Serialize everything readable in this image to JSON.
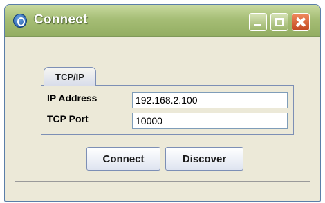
{
  "window": {
    "title": "Connect",
    "app_icon": "app-logo-icon",
    "controls": {
      "minimize": "minimize-icon",
      "maximize": "maximize-icon",
      "close": "close-icon"
    }
  },
  "tab": {
    "label": "TCP/IP"
  },
  "form": {
    "ip_label": "IP Address",
    "ip_value": "192.168.2.100",
    "port_label": "TCP Port",
    "port_value": "10000"
  },
  "buttons": {
    "connect_label": "Connect",
    "discover_label": "Discover"
  },
  "status": {
    "text": ""
  },
  "colors": {
    "titlebar": "#a6be76",
    "window_bg": "#ece9d8",
    "close_button": "#d5572b",
    "border": "#7d8fb5"
  }
}
